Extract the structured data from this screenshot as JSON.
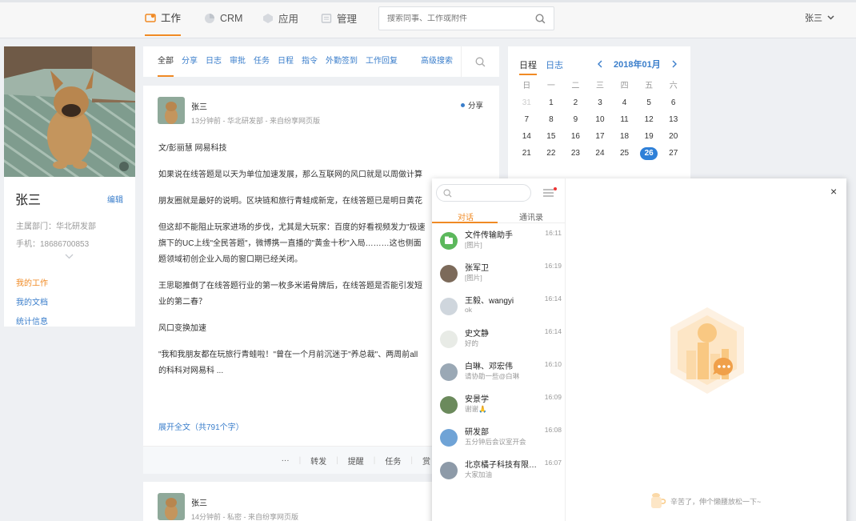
{
  "nav": {
    "work": "工作",
    "crm": "CRM",
    "apps": "应用",
    "admin": "管理",
    "search_placeholder": "搜索同事、工作或附件",
    "user": "张三"
  },
  "profile": {
    "name": "张三",
    "edit": "编辑",
    "dept": "主属部门：华北研发部",
    "phone": "手机：18686700853",
    "links": [
      "我的工作",
      "我的文档",
      "统计信息"
    ]
  },
  "feed": {
    "tabs": [
      "全部",
      "分享",
      "日志",
      "审批",
      "任务",
      "日程",
      "指令",
      "外勤签到",
      "工作回复"
    ],
    "advanced_search": "高级搜索",
    "post": {
      "author": "张三",
      "meta": "13分钟前 - 华北研发部 - 来自纷享网页版",
      "type": "分享",
      "paragraphs": [
        "文/彭丽慧 网易科技",
        "如果说在线答题是以天为单位加速发展，那么互联网的风口就是以周做计算",
        "朋友圈就是最好的说明。区块链和旅行青蛙成新宠，在线答题已是明日黄花",
        "但这却不能阻止玩家进场的步伐，尤其是大玩家：百度的好看视频发力\"极速",
        "旗下的UC上线\"全民答题\"，微博携一直播的\"黄金十秒\"入局………这也侧面",
        "题领域初创企业入局的窗口期已经关闭。",
        "王思聪推倒了在线答题行业的第一枚多米诺骨牌后，在线答题是否能引发短",
        "业的第二春？",
        "风口变换加速",
        "\"我和我朋友都在玩旅行青蛙啦！\"曾在一个月前沉迷于\"养总裁\"、两周前all",
        "的科科对网易科 ..."
      ],
      "expand": "展开全文（共791个字）",
      "actions": [
        "···",
        "转发",
        "提醒",
        "任务",
        "赏"
      ]
    },
    "post2": {
      "author": "张三",
      "meta": "14分钟前 - 私密 - 来自纷享网页版"
    }
  },
  "calendar": {
    "tab_schedule": "日程",
    "tab_log": "日志",
    "month": "2018年01月",
    "weekdays": [
      "日",
      "一",
      "二",
      "三",
      "四",
      "五",
      "六"
    ],
    "days": [
      "31",
      "1",
      "2",
      "3",
      "4",
      "5",
      "6",
      "7",
      "8",
      "9",
      "10",
      "11",
      "12",
      "13",
      "14",
      "15",
      "16",
      "17",
      "18",
      "19",
      "20",
      "21",
      "22",
      "23",
      "24",
      "25",
      "26",
      "27"
    ],
    "today": "26"
  },
  "chat": {
    "tab_conversations": "对话",
    "tab_contacts": "通讯录",
    "close": "×",
    "conversations": [
      {
        "name": "文件传输助手",
        "time": "16:11",
        "msg": "[图片]"
      },
      {
        "name": "张军卫",
        "time": "16:19",
        "msg": "[图片]"
      },
      {
        "name": "王毅、wangyi",
        "time": "16:14",
        "msg": "ok"
      },
      {
        "name": "史文静",
        "time": "16:14",
        "msg": "好的"
      },
      {
        "name": "白琳、邓宏伟",
        "time": "16:10",
        "msg": "请协助一些@白琳"
      },
      {
        "name": "安景学",
        "time": "16:09",
        "msg": "谢谢🙏"
      },
      {
        "name": "研发部",
        "time": "16:08",
        "msg": "五分钟后会议室开会"
      },
      {
        "name": "北京橘子科技有限公...",
        "time": "16:07",
        "msg": "大家加油"
      }
    ],
    "empty_tip": "辛苦了，伸个懒腰放松一下~"
  },
  "colors": {
    "accent": "#f08a24",
    "link": "#3a7ecb",
    "today": "#2f80d8"
  }
}
